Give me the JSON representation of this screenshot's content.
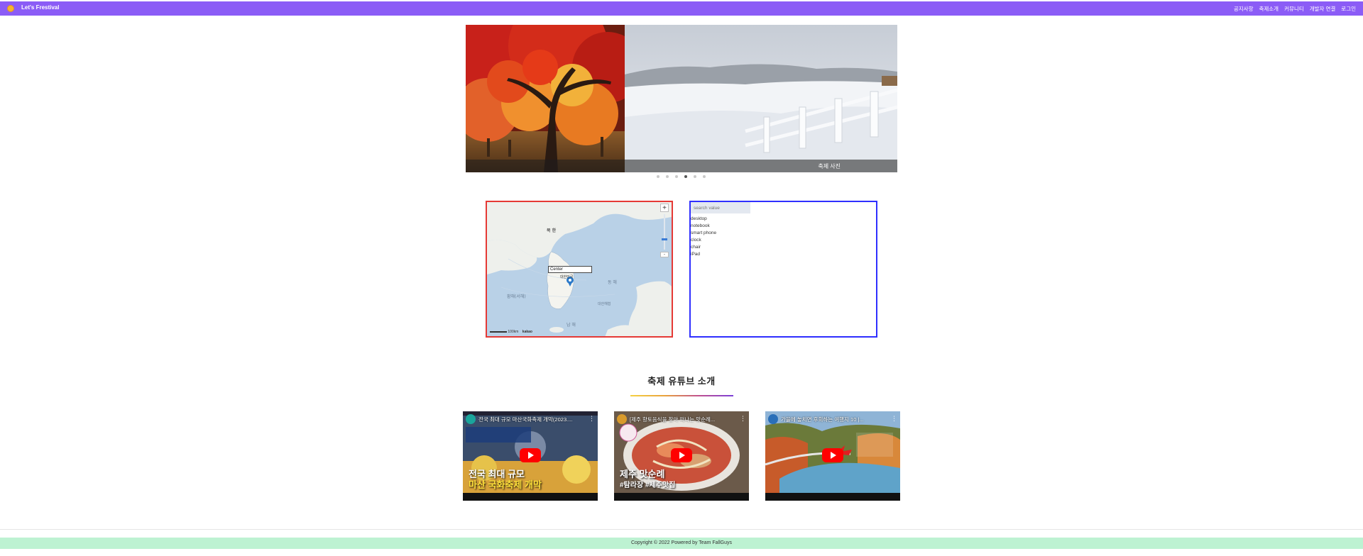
{
  "navbar": {
    "brand": "Let's Frestival",
    "links": [
      "공지사항",
      "축제소개",
      "커뮤니티",
      "개발자 연결",
      "로그인"
    ]
  },
  "carousel": {
    "caption": "축제 사진",
    "slide_count": 6,
    "active_index": 3
  },
  "map": {
    "center_label": "Center",
    "zoom_in": "+",
    "zoom_out": "-",
    "scale_label": "100km",
    "provider": "kakao",
    "place_labels": [
      "북한",
      "대한민국",
      "동해",
      "황해(서해)",
      "남해",
      "대한해협"
    ]
  },
  "list": {
    "search_placeholder": "search value",
    "items": [
      "desktop",
      "notebook",
      "smart phone",
      "clock",
      "chair",
      "iPad"
    ]
  },
  "youtube": {
    "heading": "축제 유튜브 소개",
    "videos": [
      {
        "title": "전국 최대 규모 마산국화축제 개막(2023....",
        "overlay": "전국 최대 규모",
        "overlay2": "마산 국화축제 개막"
      },
      {
        "title": "[제주 향토음식을 찾아 떠나는 맛순례...",
        "overlay": "제주 맛순례",
        "overlay2": "#탐라장 #제주맛집"
      },
      {
        "title": "가을에 놓치면 후회하는 여행지 10 |...",
        "overlay": "",
        "overlay2": ""
      }
    ]
  },
  "footer": {
    "copyright": "Copyright © 2022 Powered by Team FallGuys"
  },
  "colors": {
    "navbar": "#8b5cf6",
    "map_border": "#e53935",
    "list_border": "#2f2fff",
    "footer": "#bdf2d2"
  }
}
